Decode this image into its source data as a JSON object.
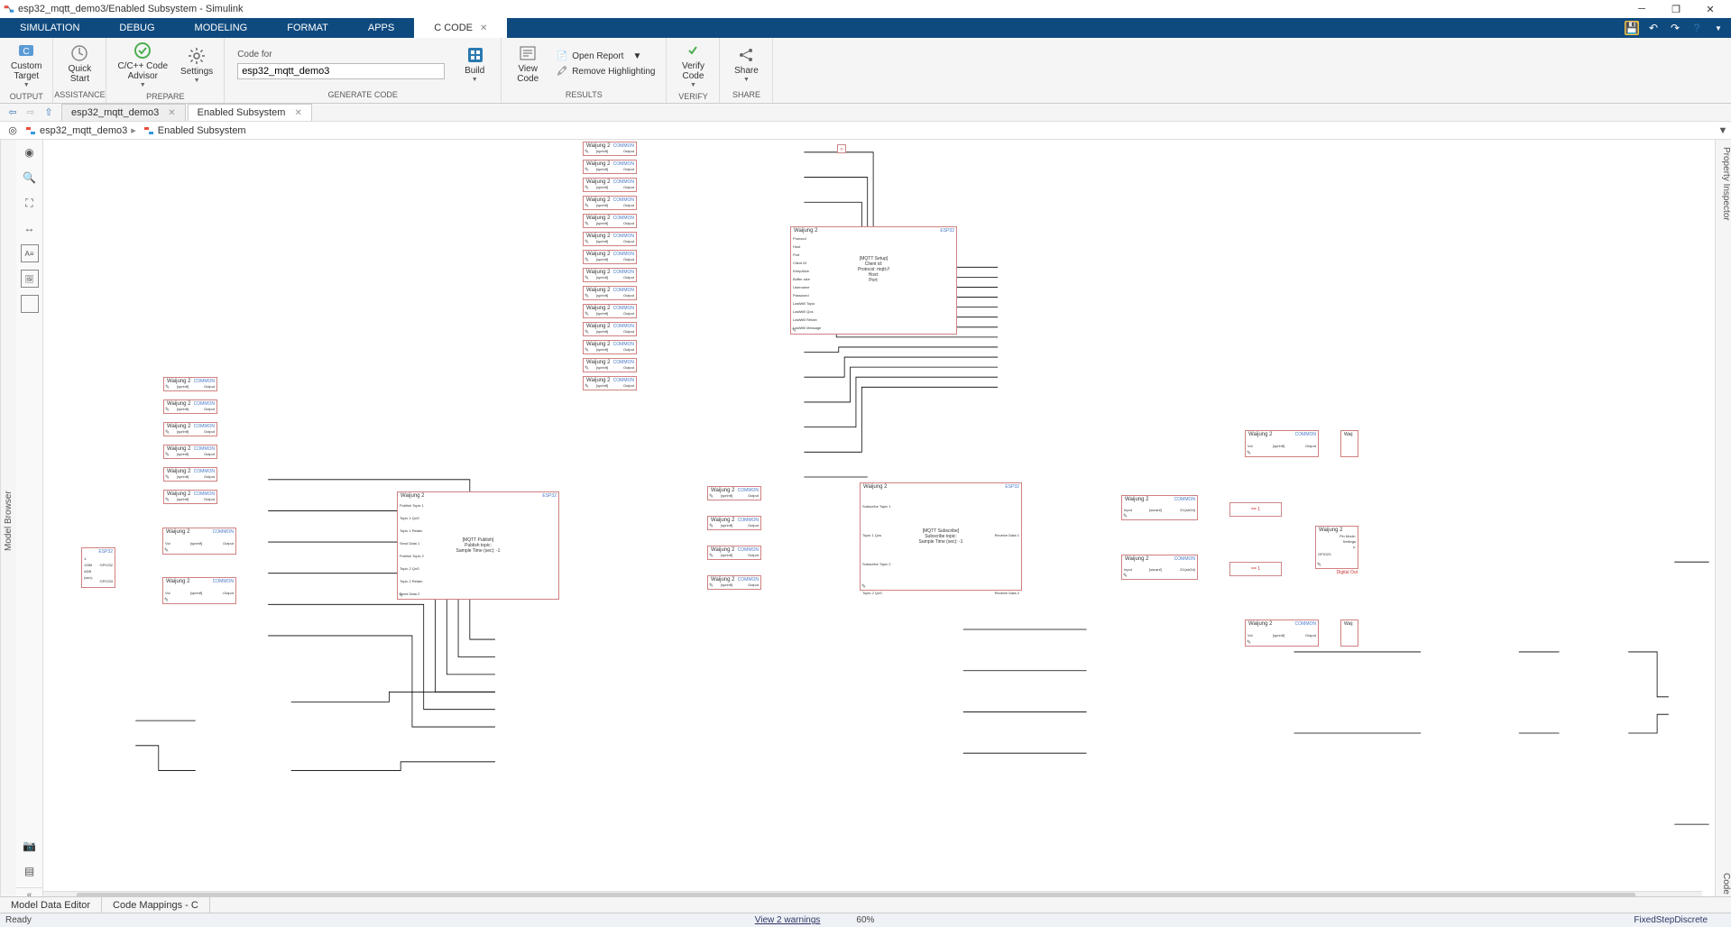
{
  "window": {
    "title": "esp32_mqtt_demo3/Enabled Subsystem - Simulink"
  },
  "menu_tabs": {
    "items": [
      "SIMULATION",
      "DEBUG",
      "MODELING",
      "FORMAT",
      "APPS",
      "C CODE"
    ],
    "active_index": 5
  },
  "toolstrip": {
    "output": {
      "label": "OUTPUT",
      "custom_target": "Custom\nTarget"
    },
    "assistance": {
      "label": "ASSISTANCE",
      "quick_start": "Quick\nStart"
    },
    "prepare": {
      "label": "PREPARE",
      "advisor": "C/C++ Code\nAdvisor",
      "settings": "Settings"
    },
    "generate": {
      "label": "GENERATE CODE",
      "code_for": "Code for",
      "code_for_value": "esp32_mqtt_demo3",
      "build": "Build"
    },
    "results": {
      "label": "RESULTS",
      "view_code": "View\nCode",
      "open_report": "Open Report",
      "remove_hl": "Remove Highlighting"
    },
    "verify": {
      "label": "VERIFY",
      "verify_code": "Verify\nCode"
    },
    "share": {
      "label": "SHARE",
      "share": "Share"
    }
  },
  "doc_tabs": {
    "items": [
      {
        "label": "esp32_mqtt_demo3",
        "closable": true,
        "active": false
      },
      {
        "label": "Enabled Subsystem",
        "closable": true,
        "active": true
      }
    ]
  },
  "breadcrumb": {
    "model": "esp32_mqtt_demo3",
    "subsystem": "Enabled Subsystem"
  },
  "side_tabs": {
    "left": "Model Browser",
    "right_top": "Property Inspector",
    "right_bottom": "Code"
  },
  "bottom_tabs": {
    "items": [
      "Model Data Editor",
      "Code Mappings - C"
    ]
  },
  "statusbar": {
    "ready": "Ready",
    "warnings": "View 2 warnings",
    "zoom": "60%",
    "solver": "FixedStepDiscrete"
  },
  "blocks": {
    "waijung_label": "Waijung 2",
    "common_tag": "COMMON",
    "esp32_tag": "ESP32",
    "sprintf": "[sprintf]",
    "output": "Output",
    "input": "Input",
    "sscanf": "[sscanf]",
    "d1_str2d": "D1(str2d)",
    "vol": "Vol",
    "eq1": "== 1",
    "mqtt_setup": {
      "title": "[MQTT Setup]",
      "lines": [
        "Client id:",
        "Protocol: mqtt://",
        "Host:",
        "Port:"
      ],
      "ports": [
        "Protocol",
        "Host",
        "Port",
        "Client ID",
        "KeepAlive",
        "Buffer size",
        "Username",
        "Password",
        "LastWill Topic",
        "LastWill Qos",
        "LastWill Retain",
        "LastWill Message"
      ]
    },
    "mqtt_publish": {
      "title": "[MQTT Publish]",
      "lines": [
        "Publish topic:",
        "Sample Time (sec): -1"
      ],
      "ports": [
        "Publish Topic 1",
        "Topic 1 QoS",
        "Topic 1 Retain",
        "Send Data 1",
        "Publish Topic 2",
        "Topic 2 QoS",
        "Topic 2 Retain",
        "Send Data 2"
      ]
    },
    "mqtt_subscribe": {
      "title": "[MQTT Subscribe]",
      "lines": [
        "Subscribe topic:",
        "Sample Time (sec): -1"
      ],
      "in_ports": [
        "Subscribe Topic 1",
        "Topic 1 Qos",
        "Subscribe Topic 2",
        "Topic 2 QoS"
      ],
      "out_ports": [
        "Receive Data 1",
        "Receive Data 2"
      ]
    },
    "adc": {
      "lines": [
        "1:",
        "12Bit",
        "ADB",
        "(sec):"
      ],
      "out_ports": [
        "GPIO32",
        "GPIO33"
      ]
    },
    "digital_out": {
      "lines": [
        "Pin Mode:",
        "Settings",
        "s:"
      ],
      "port": "GPIO23",
      "label": "Digital Out"
    }
  }
}
